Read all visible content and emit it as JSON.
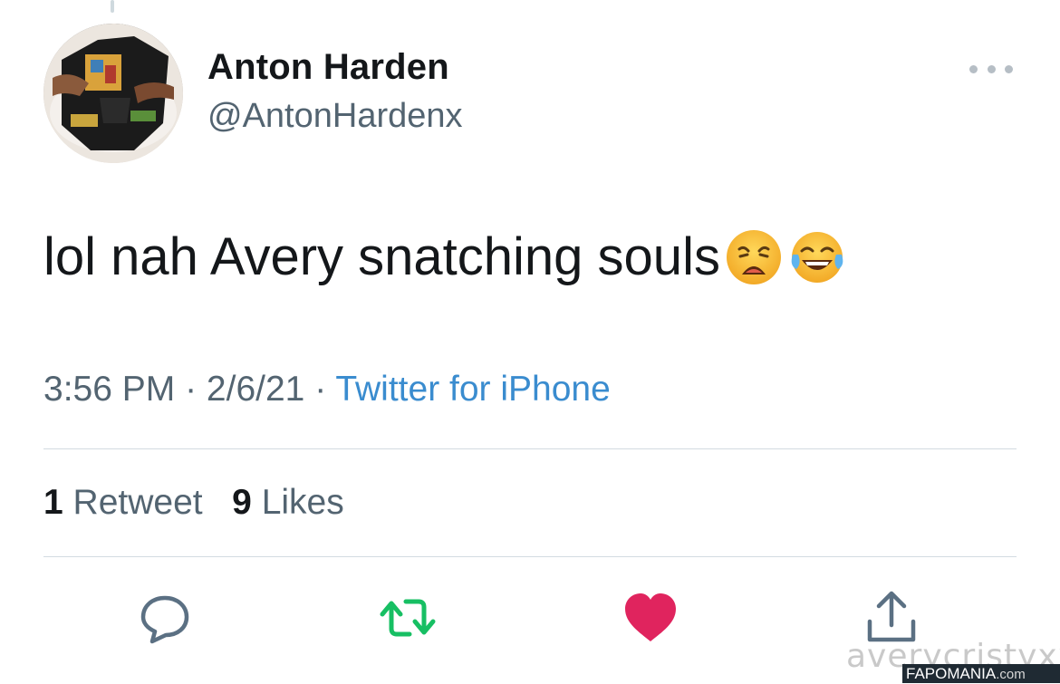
{
  "tweet": {
    "author": {
      "display_name": "Anton Harden",
      "handle": "@AntonHardenx"
    },
    "text": "lol nah Avery snatching souls",
    "emojis": [
      "weary-face",
      "face-with-tears-of-joy"
    ],
    "time": "3:56 PM",
    "date": "2/6/21",
    "separator": " · ",
    "source": "Twitter for iPhone",
    "retweets": {
      "count": "1",
      "label": "Retweet"
    },
    "likes": {
      "count": "9",
      "label": "Likes"
    },
    "liked": true
  },
  "actions": [
    {
      "icon": "reply-icon"
    },
    {
      "icon": "retweet-icon",
      "color": "#17bf63"
    },
    {
      "icon": "heart-filled-icon",
      "color": "#e0245e"
    },
    {
      "icon": "share-icon"
    }
  ],
  "watermark": {
    "script_text": "averycristyxxx",
    "bar_text": "FAPOMANIA",
    "bar_suffix": ".com"
  }
}
